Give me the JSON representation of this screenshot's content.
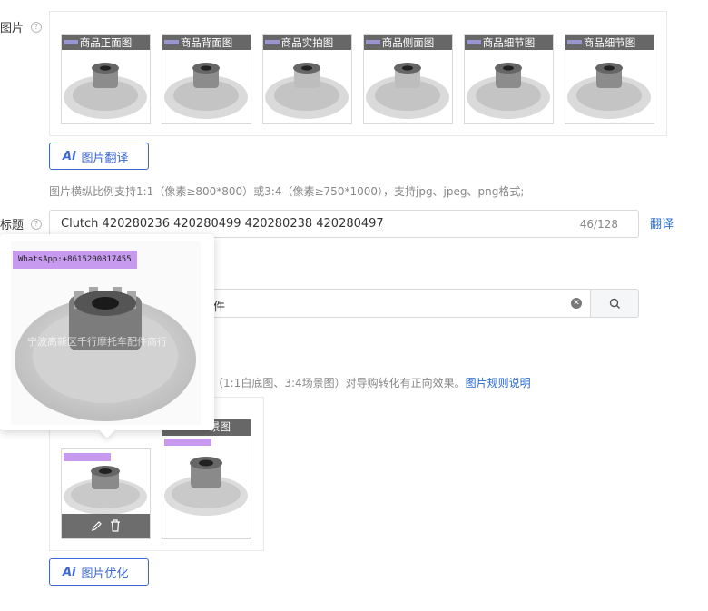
{
  "images_section": {
    "label": "图片",
    "help_icon": "question-circle-icon",
    "thumbnails": [
      {
        "caption": "商品正面图"
      },
      {
        "caption": "商品背面图"
      },
      {
        "caption": "商品实拍图"
      },
      {
        "caption": "商品侧面图"
      },
      {
        "caption": "商品细节图"
      },
      {
        "caption": "商品细节图"
      }
    ],
    "translate_button": {
      "ai": "Ai",
      "label": "图片翻译"
    },
    "hint": "图片横纵比例支持1:1（像素≥800*800）或3:4（像素≥750*1000），支持jpg、jpeg、png格式;"
  },
  "title_section": {
    "label": "标题",
    "value": "Clutch 420280236 420280499 420280238 420280497",
    "counter": "46/128",
    "translate_link": "翻译"
  },
  "search_field": {
    "value": "件"
  },
  "rule_hint": {
    "text": "（1:1白底图、3:4场景图）对导购转化有正向效果。",
    "link": "图片规则说明"
  },
  "marketing_images": {
    "second_caption": "景图",
    "optimize_button": {
      "ai": "Ai",
      "label": "图片优化"
    }
  },
  "popover": {
    "watermark": "WhatsApp:+8615200817455",
    "overlay_text": "宁波高新区千行摩托车配件商行"
  },
  "colors": {
    "accent": "#3a66d6",
    "watermark_bg": "#c79af0"
  }
}
